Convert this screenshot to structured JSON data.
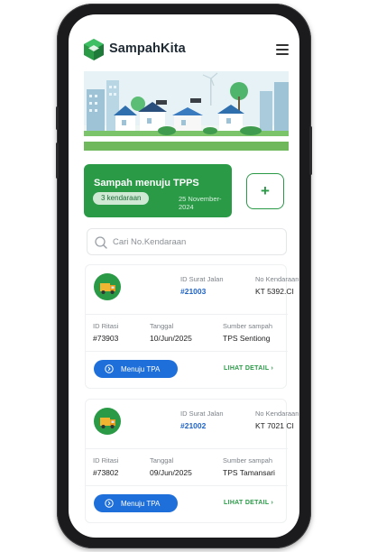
{
  "app": {
    "brand": "SampahKita"
  },
  "status": {
    "title": "Sampah menuju TPPS",
    "badge": "3 kendaraan",
    "date": "25 November-2024"
  },
  "actions": {
    "add_label": "+"
  },
  "search": {
    "placeholder": "Cari No.Kendaraan",
    "value": ""
  },
  "icons": {
    "logo": "hexagon-logo-icon",
    "menu": "hamburger-menu-icon",
    "search": "search-icon",
    "truck": "truck-icon",
    "arrow": "arrow-right-circle-icon",
    "chevron": "chevron-right-icon"
  },
  "colors": {
    "primary_green": "#2a9a47",
    "accent_blue": "#1e6fd9",
    "link_blue": "#1e63c8"
  },
  "shipments": [
    {
      "id_label": "ID Surat Jalan",
      "id": "#21003",
      "plate_label": "No Kendaraan",
      "plate": "KT 5392.CI",
      "ritasi_label": "ID Ritasi",
      "ritasi": "#73903",
      "date_label": "Tanggal",
      "date": "10/Jun/2025",
      "source_label": "Sumber sampah",
      "source": "TPS Sentiong",
      "action_label": "Menuju TPA",
      "detail_label": "LIHAT DETAIL"
    },
    {
      "id_label": "ID Surat Jalan",
      "id": "#21002",
      "plate_label": "No Kendaraan",
      "plate": "KT 7021 CI",
      "ritasi_label": "ID Ritasi",
      "ritasi": "#73802",
      "date_label": "Tanggal",
      "date": "09/Jun/2025",
      "source_label": "Sumber sampah",
      "source": "TPS Tamansari",
      "action_label": "Menuju TPA",
      "detail_label": "LIHAT DETAIL"
    }
  ]
}
